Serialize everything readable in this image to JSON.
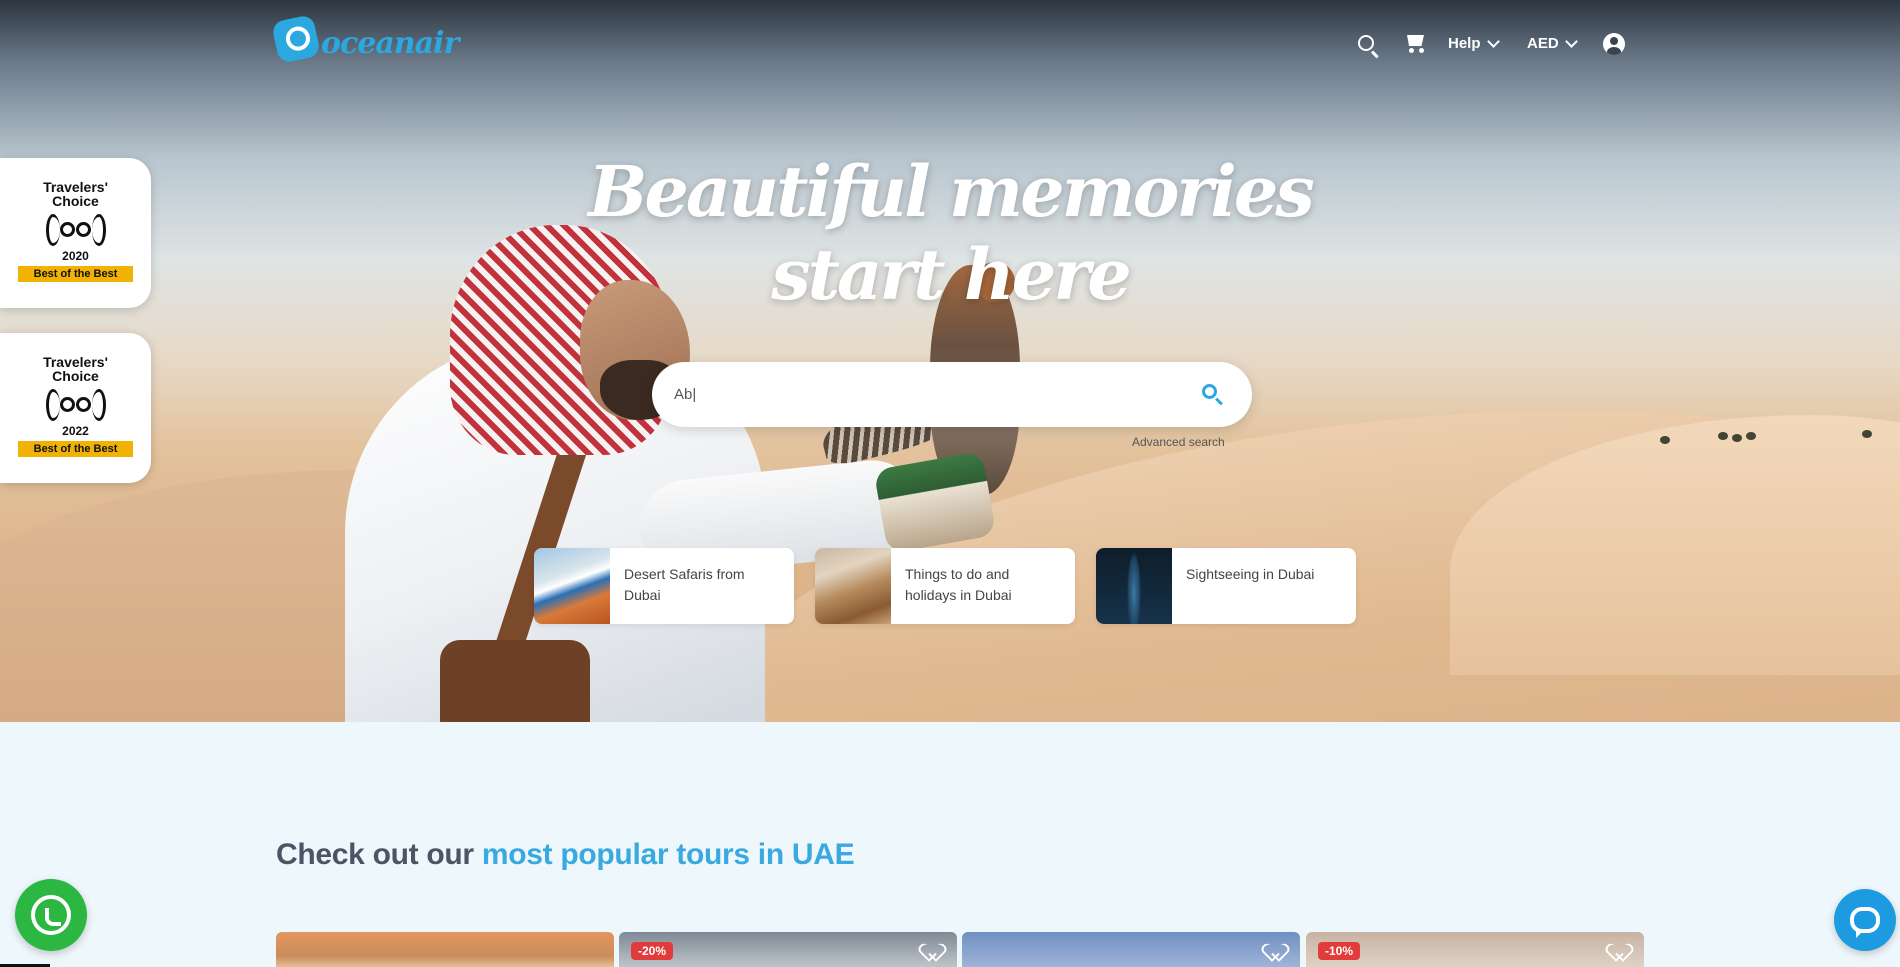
{
  "brand": {
    "name": "oceanair",
    "accent": "#2ba8e0"
  },
  "nav": {
    "search_icon": "search-icon",
    "cart_icon": "cart-icon",
    "help_label": "Help",
    "currency_label": "AED",
    "account_icon": "user-circle-icon"
  },
  "badges": [
    {
      "title": "Travelers' Choice",
      "year": "2020",
      "ribbon": "Best of the Best"
    },
    {
      "title": "Travelers' Choice",
      "year": "2022",
      "ribbon": "Best of the Best"
    }
  ],
  "hero": {
    "headline": "Beautiful memories start here",
    "search": {
      "value": "Ab|",
      "placeholder": ""
    },
    "advanced_search": "Advanced search"
  },
  "categories": [
    {
      "label": "Desert Safaris from Dubai"
    },
    {
      "label": "Things to do and holidays in Dubai"
    },
    {
      "label": "Sightseeing in Dubai"
    }
  ],
  "section": {
    "title_plain": "Check out our ",
    "title_highlight": "most popular tours in UAE"
  },
  "tours": [
    {
      "discount": ""
    },
    {
      "discount": "-20%"
    },
    {
      "discount": ""
    },
    {
      "discount": "-10%"
    }
  ],
  "floating": {
    "whatsapp_icon": "whatsapp-icon",
    "chat_icon": "chat-icon"
  }
}
